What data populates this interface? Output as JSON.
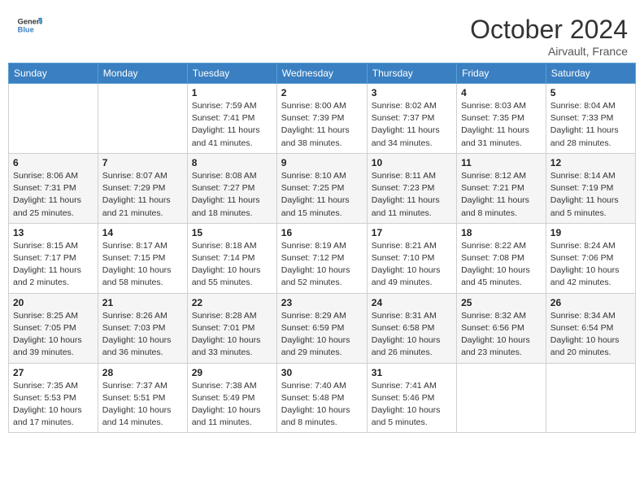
{
  "header": {
    "logo_line1": "General",
    "logo_line2": "Blue",
    "month": "October 2024",
    "location": "Airvault, France"
  },
  "weekdays": [
    "Sunday",
    "Monday",
    "Tuesday",
    "Wednesday",
    "Thursday",
    "Friday",
    "Saturday"
  ],
  "weeks": [
    [
      null,
      null,
      {
        "day": 1,
        "sunrise": "Sunrise: 7:59 AM",
        "sunset": "Sunset: 7:41 PM",
        "daylight": "Daylight: 11 hours and 41 minutes."
      },
      {
        "day": 2,
        "sunrise": "Sunrise: 8:00 AM",
        "sunset": "Sunset: 7:39 PM",
        "daylight": "Daylight: 11 hours and 38 minutes."
      },
      {
        "day": 3,
        "sunrise": "Sunrise: 8:02 AM",
        "sunset": "Sunset: 7:37 PM",
        "daylight": "Daylight: 11 hours and 34 minutes."
      },
      {
        "day": 4,
        "sunrise": "Sunrise: 8:03 AM",
        "sunset": "Sunset: 7:35 PM",
        "daylight": "Daylight: 11 hours and 31 minutes."
      },
      {
        "day": 5,
        "sunrise": "Sunrise: 8:04 AM",
        "sunset": "Sunset: 7:33 PM",
        "daylight": "Daylight: 11 hours and 28 minutes."
      }
    ],
    [
      {
        "day": 6,
        "sunrise": "Sunrise: 8:06 AM",
        "sunset": "Sunset: 7:31 PM",
        "daylight": "Daylight: 11 hours and 25 minutes."
      },
      {
        "day": 7,
        "sunrise": "Sunrise: 8:07 AM",
        "sunset": "Sunset: 7:29 PM",
        "daylight": "Daylight: 11 hours and 21 minutes."
      },
      {
        "day": 8,
        "sunrise": "Sunrise: 8:08 AM",
        "sunset": "Sunset: 7:27 PM",
        "daylight": "Daylight: 11 hours and 18 minutes."
      },
      {
        "day": 9,
        "sunrise": "Sunrise: 8:10 AM",
        "sunset": "Sunset: 7:25 PM",
        "daylight": "Daylight: 11 hours and 15 minutes."
      },
      {
        "day": 10,
        "sunrise": "Sunrise: 8:11 AM",
        "sunset": "Sunset: 7:23 PM",
        "daylight": "Daylight: 11 hours and 11 minutes."
      },
      {
        "day": 11,
        "sunrise": "Sunrise: 8:12 AM",
        "sunset": "Sunset: 7:21 PM",
        "daylight": "Daylight: 11 hours and 8 minutes."
      },
      {
        "day": 12,
        "sunrise": "Sunrise: 8:14 AM",
        "sunset": "Sunset: 7:19 PM",
        "daylight": "Daylight: 11 hours and 5 minutes."
      }
    ],
    [
      {
        "day": 13,
        "sunrise": "Sunrise: 8:15 AM",
        "sunset": "Sunset: 7:17 PM",
        "daylight": "Daylight: 11 hours and 2 minutes."
      },
      {
        "day": 14,
        "sunrise": "Sunrise: 8:17 AM",
        "sunset": "Sunset: 7:15 PM",
        "daylight": "Daylight: 10 hours and 58 minutes."
      },
      {
        "day": 15,
        "sunrise": "Sunrise: 8:18 AM",
        "sunset": "Sunset: 7:14 PM",
        "daylight": "Daylight: 10 hours and 55 minutes."
      },
      {
        "day": 16,
        "sunrise": "Sunrise: 8:19 AM",
        "sunset": "Sunset: 7:12 PM",
        "daylight": "Daylight: 10 hours and 52 minutes."
      },
      {
        "day": 17,
        "sunrise": "Sunrise: 8:21 AM",
        "sunset": "Sunset: 7:10 PM",
        "daylight": "Daylight: 10 hours and 49 minutes."
      },
      {
        "day": 18,
        "sunrise": "Sunrise: 8:22 AM",
        "sunset": "Sunset: 7:08 PM",
        "daylight": "Daylight: 10 hours and 45 minutes."
      },
      {
        "day": 19,
        "sunrise": "Sunrise: 8:24 AM",
        "sunset": "Sunset: 7:06 PM",
        "daylight": "Daylight: 10 hours and 42 minutes."
      }
    ],
    [
      {
        "day": 20,
        "sunrise": "Sunrise: 8:25 AM",
        "sunset": "Sunset: 7:05 PM",
        "daylight": "Daylight: 10 hours and 39 minutes."
      },
      {
        "day": 21,
        "sunrise": "Sunrise: 8:26 AM",
        "sunset": "Sunset: 7:03 PM",
        "daylight": "Daylight: 10 hours and 36 minutes."
      },
      {
        "day": 22,
        "sunrise": "Sunrise: 8:28 AM",
        "sunset": "Sunset: 7:01 PM",
        "daylight": "Daylight: 10 hours and 33 minutes."
      },
      {
        "day": 23,
        "sunrise": "Sunrise: 8:29 AM",
        "sunset": "Sunset: 6:59 PM",
        "daylight": "Daylight: 10 hours and 29 minutes."
      },
      {
        "day": 24,
        "sunrise": "Sunrise: 8:31 AM",
        "sunset": "Sunset: 6:58 PM",
        "daylight": "Daylight: 10 hours and 26 minutes."
      },
      {
        "day": 25,
        "sunrise": "Sunrise: 8:32 AM",
        "sunset": "Sunset: 6:56 PM",
        "daylight": "Daylight: 10 hours and 23 minutes."
      },
      {
        "day": 26,
        "sunrise": "Sunrise: 8:34 AM",
        "sunset": "Sunset: 6:54 PM",
        "daylight": "Daylight: 10 hours and 20 minutes."
      }
    ],
    [
      {
        "day": 27,
        "sunrise": "Sunrise: 7:35 AM",
        "sunset": "Sunset: 5:53 PM",
        "daylight": "Daylight: 10 hours and 17 minutes."
      },
      {
        "day": 28,
        "sunrise": "Sunrise: 7:37 AM",
        "sunset": "Sunset: 5:51 PM",
        "daylight": "Daylight: 10 hours and 14 minutes."
      },
      {
        "day": 29,
        "sunrise": "Sunrise: 7:38 AM",
        "sunset": "Sunset: 5:49 PM",
        "daylight": "Daylight: 10 hours and 11 minutes."
      },
      {
        "day": 30,
        "sunrise": "Sunrise: 7:40 AM",
        "sunset": "Sunset: 5:48 PM",
        "daylight": "Daylight: 10 hours and 8 minutes."
      },
      {
        "day": 31,
        "sunrise": "Sunrise: 7:41 AM",
        "sunset": "Sunset: 5:46 PM",
        "daylight": "Daylight: 10 hours and 5 minutes."
      },
      null,
      null
    ]
  ]
}
